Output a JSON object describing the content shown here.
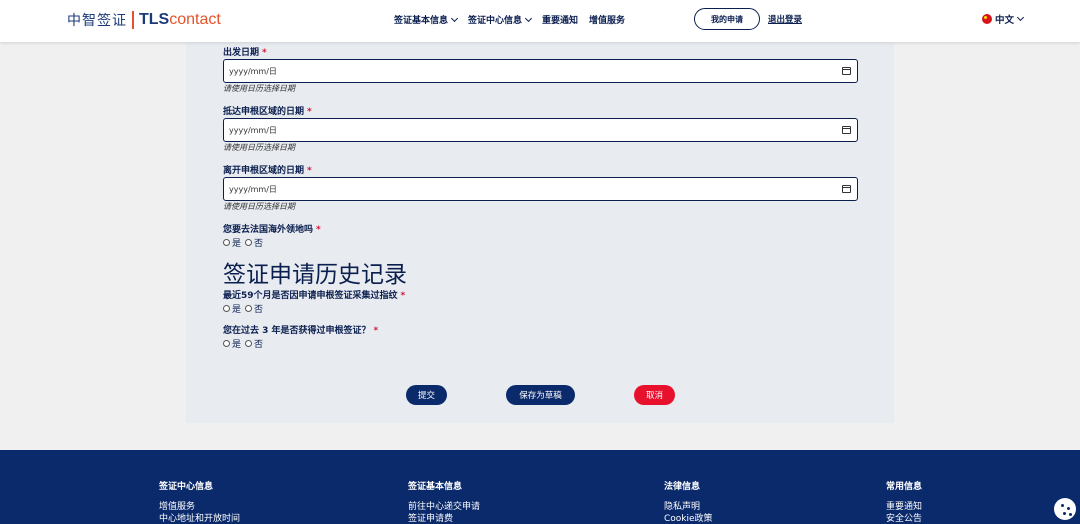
{
  "header": {
    "logo_cn": "中智签证",
    "logo_tls": "TLS",
    "logo_contact": "contact",
    "nav": [
      {
        "label": "签证基本信息",
        "dropdown": true
      },
      {
        "label": "签证中心信息",
        "dropdown": true
      },
      {
        "label": "重要通知",
        "dropdown": false
      },
      {
        "label": "增值服务",
        "dropdown": false
      }
    ],
    "my_application": "我的申请",
    "logout": "退出登录",
    "language": "中文"
  },
  "form": {
    "date_fields": [
      {
        "label": "出发日期",
        "placeholder": "yyyy/mm/日",
        "hint": "请使用日历选择日期"
      },
      {
        "label": "抵达申根区域的日期",
        "placeholder": "yyyy/mm/日",
        "hint": "请使用日历选择日期"
      },
      {
        "label": "离开申根区域的日期",
        "placeholder": "yyyy/mm/日",
        "hint": "请使用日历选择日期"
      }
    ],
    "overseas_question": "您要去法国海外领地吗",
    "yes": "是",
    "no": "否",
    "history_title": "签证申请历史记录",
    "fingerprint_question": "最近59个月是否因申请申根签证采集过指纹",
    "visa_question": "您在过去 3 年是否获得过申根签证？",
    "required_mark": "*"
  },
  "buttons": {
    "submit": "提交",
    "save_draft": "保存为草稿",
    "cancel": "取消"
  },
  "footer": {
    "columns": [
      {
        "title": "签证中心信息",
        "items": [
          "增值服务",
          "中心地址和开放时间"
        ]
      },
      {
        "title": "签证基本信息",
        "items": [
          "前往中心递交申请",
          "签证申请费"
        ]
      },
      {
        "title": "法律信息",
        "items": [
          "隐私声明",
          "Cookie政策"
        ]
      },
      {
        "title": "常用信息",
        "items": [
          "重要通知",
          "安全公告"
        ]
      }
    ]
  },
  "colors": {
    "brand_navy": "#0b2a6b",
    "accent_red": "#e8112d",
    "logo_orange": "#e4532c"
  }
}
